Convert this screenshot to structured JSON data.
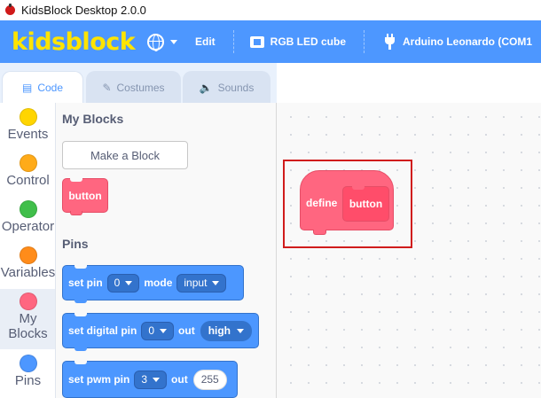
{
  "window": {
    "title": "KidsBlock Desktop 2.0.0"
  },
  "menubar": {
    "logo": "kidsblock",
    "edit": "Edit",
    "device": "RGB LED cube",
    "board": "Arduino Leonardo (COM1"
  },
  "tabs": [
    {
      "label": "Code",
      "icon": "code-icon",
      "active": true
    },
    {
      "label": "Costumes",
      "icon": "brush-icon",
      "active": false
    },
    {
      "label": "Sounds",
      "icon": "speaker-icon",
      "active": false
    }
  ],
  "categories": [
    {
      "label": "Events",
      "color": "#ffd500"
    },
    {
      "label": "Control",
      "color": "#ffab19"
    },
    {
      "label": "Operator",
      "color": "#40bf4a"
    },
    {
      "label": "Variables",
      "color": "#ff8c1a"
    },
    {
      "label": "My Blocks",
      "color": "#ff6680",
      "selected": true
    },
    {
      "label": "Pins",
      "color": "#4d97ff"
    }
  ],
  "palette": {
    "my_blocks_heading": "My Blocks",
    "make_block": "Make a Block",
    "custom_block": "button",
    "pins_heading": "Pins",
    "set_pin": {
      "label": "set pin",
      "pin": "0",
      "mode_label": "mode",
      "mode": "input"
    },
    "set_digital": {
      "label": "set digital pin",
      "pin": "0",
      "out_label": "out",
      "level": "high"
    },
    "set_pwm": {
      "label": "set pwm pin",
      "pin": "3",
      "out_label": "out",
      "value": "255"
    }
  },
  "workspace": {
    "define_label": "define",
    "define_name": "button"
  },
  "colors": {
    "menubar": "#4d97ff",
    "logo": "#ffe400",
    "my_blocks": "#ff6680",
    "pins": "#4c97ff",
    "highlight": "#d01c1c"
  }
}
